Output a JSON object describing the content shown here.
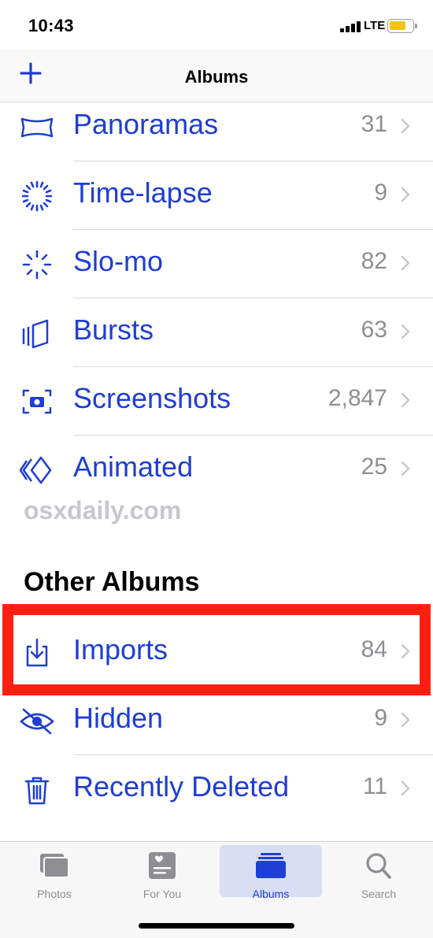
{
  "status": {
    "time": "10:43",
    "network": "LTE"
  },
  "nav": {
    "title": "Albums"
  },
  "media_types": [
    {
      "icon": "panorama-icon",
      "label": "Panoramas",
      "count": "31"
    },
    {
      "icon": "timelapse-icon",
      "label": "Time-lapse",
      "count": "9"
    },
    {
      "icon": "slomo-icon",
      "label": "Slo-mo",
      "count": "82"
    },
    {
      "icon": "bursts-icon",
      "label": "Bursts",
      "count": "63"
    },
    {
      "icon": "screenshots-icon",
      "label": "Screenshots",
      "count": "2,847"
    },
    {
      "icon": "animated-icon",
      "label": "Animated",
      "count": "25"
    }
  ],
  "watermark": "osxdaily.com",
  "other_albums": {
    "title": "Other Albums",
    "items": [
      {
        "icon": "import-icon",
        "label": "Imports",
        "count": "84"
      },
      {
        "icon": "hidden-eye-icon",
        "label": "Hidden",
        "count": "9"
      },
      {
        "icon": "trash-icon",
        "label": "Recently Deleted",
        "count": "11"
      }
    ]
  },
  "tabs": [
    {
      "icon": "photos-tab-icon",
      "label": "Photos",
      "active": false
    },
    {
      "icon": "for-you-tab-icon",
      "label": "For You",
      "active": false
    },
    {
      "icon": "albums-tab-icon",
      "label": "Albums",
      "active": true
    },
    {
      "icon": "search-tab-icon",
      "label": "Search",
      "active": false
    }
  ],
  "colors": {
    "accent": "#1f3ed4",
    "count_gray": "#8e8e93",
    "highlight": "#ff1f10",
    "battery": "#f2c318"
  }
}
